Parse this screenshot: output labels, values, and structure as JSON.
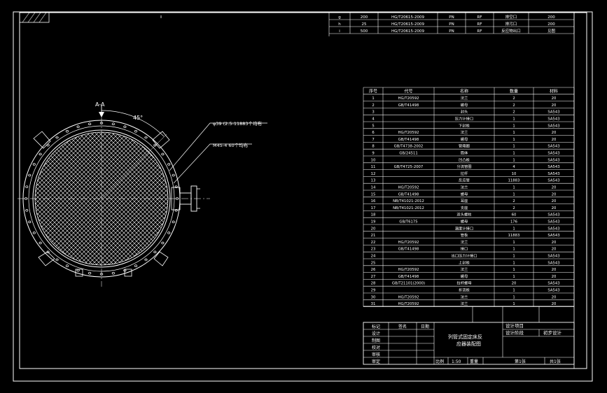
{
  "window": {
    "background": "#000000",
    "line_color": "#ffffff"
  },
  "view": {
    "section_label": "A-A",
    "angle_label": "45°",
    "callout_holes": "φ39 (2.5-11883个均布",
    "callout_bolts": "M45-4 60个均布"
  },
  "top_nozzle_table": {
    "rows": [
      [
        "g",
        "200",
        "HG/T20615-2009",
        "PN",
        "RF",
        "排空口",
        "200"
      ],
      [
        "h",
        "25",
        "HG/T20615-2009",
        "PN",
        "RF",
        "排污口",
        "200"
      ],
      [
        "i",
        "500",
        "HG/T20615-2009",
        "PN",
        "RF",
        "反应物出口",
        "见图"
      ]
    ]
  },
  "parts_table": {
    "headers": [
      "序号",
      "代号",
      "名称",
      "数量",
      "材料"
    ],
    "rows": [
      [
        "1",
        "HG/T20592",
        "法兰",
        "2",
        "20"
      ],
      [
        "2",
        "GB/T41498",
        "螺母",
        "2",
        "20"
      ],
      [
        "3",
        "",
        "封头",
        "2",
        "SA543"
      ],
      [
        "4",
        "",
        "压力计接口",
        "1",
        "SA543"
      ],
      [
        "5",
        "",
        "下封板",
        "1",
        "SA543"
      ],
      [
        "6",
        "HG/T20592",
        "法兰",
        "1",
        "20"
      ],
      [
        "7",
        "GB/T41498",
        "螺母",
        "1",
        "20"
      ],
      [
        "8",
        "GB/T4738-2002",
        "管箱圈",
        "1",
        "SA543"
      ],
      [
        "9",
        "GB/24511",
        "筒体",
        "1",
        "SA543"
      ],
      [
        "10",
        "",
        "凹凸板",
        "1",
        "SA543"
      ],
      [
        "11",
        "GB/T4725-2007",
        "分流管圈",
        "4",
        "SA543"
      ],
      [
        "12",
        "",
        "拉杆",
        "10",
        "SA543"
      ],
      [
        "13",
        "",
        "反应管",
        "11883",
        "SA543"
      ],
      [
        "14",
        "HG/T20592",
        "法兰",
        "1",
        "20"
      ],
      [
        "15",
        "GB/T41498",
        "螺母",
        "1",
        "20"
      ],
      [
        "16",
        "NB/T41021-2012",
        "耳座",
        "2",
        "20"
      ],
      [
        "17",
        "NB/T41021-2012",
        "支座",
        "2",
        "20"
      ],
      [
        "18",
        "",
        "双头螺柱",
        "60",
        "SA543"
      ],
      [
        "19",
        "GB/T6175",
        "螺母",
        "176",
        "SA543"
      ],
      [
        "20",
        "",
        "温度计接口",
        "1",
        "SA543"
      ],
      [
        "21",
        "",
        "管板",
        "11883",
        "SA543"
      ],
      [
        "22",
        "HG/T20592",
        "法兰",
        "1",
        "20"
      ],
      [
        "23",
        "GB/T41498",
        "接口",
        "1",
        "20"
      ],
      [
        "24",
        "",
        "出口压力计接口",
        "1",
        "SA543"
      ],
      [
        "25",
        "",
        "上封板",
        "1",
        "SA543"
      ],
      [
        "26",
        "HG/T20592",
        "法兰",
        "1",
        "20"
      ],
      [
        "27",
        "GB/T41498",
        "螺母",
        "1",
        "20"
      ],
      [
        "28",
        "GB/T21101(2000)",
        "拉杆螺母",
        "20",
        "SA543"
      ],
      [
        "29",
        "",
        "折流板",
        "1",
        "SA543"
      ],
      [
        "30",
        "HG/T20592",
        "法兰",
        "1",
        "20"
      ],
      [
        "31",
        "HG/T20592",
        "法兰",
        "1",
        "20"
      ]
    ]
  },
  "title_block": {
    "row_labels": [
      "标记",
      "设计",
      "制图",
      "校对",
      "审核",
      "审定"
    ],
    "col_labels": [
      "签名",
      "日期"
    ],
    "drawing_title_1": "列管式固定床反",
    "drawing_title_2": "应器装配图",
    "project_label": "设计项目",
    "stage_label": "设计阶段",
    "stage_value": "初步设计",
    "scale_label": "比例",
    "scale_value": "1:50",
    "page_label": "第1张",
    "total_label": "共1张",
    "weight_label": "重量"
  }
}
